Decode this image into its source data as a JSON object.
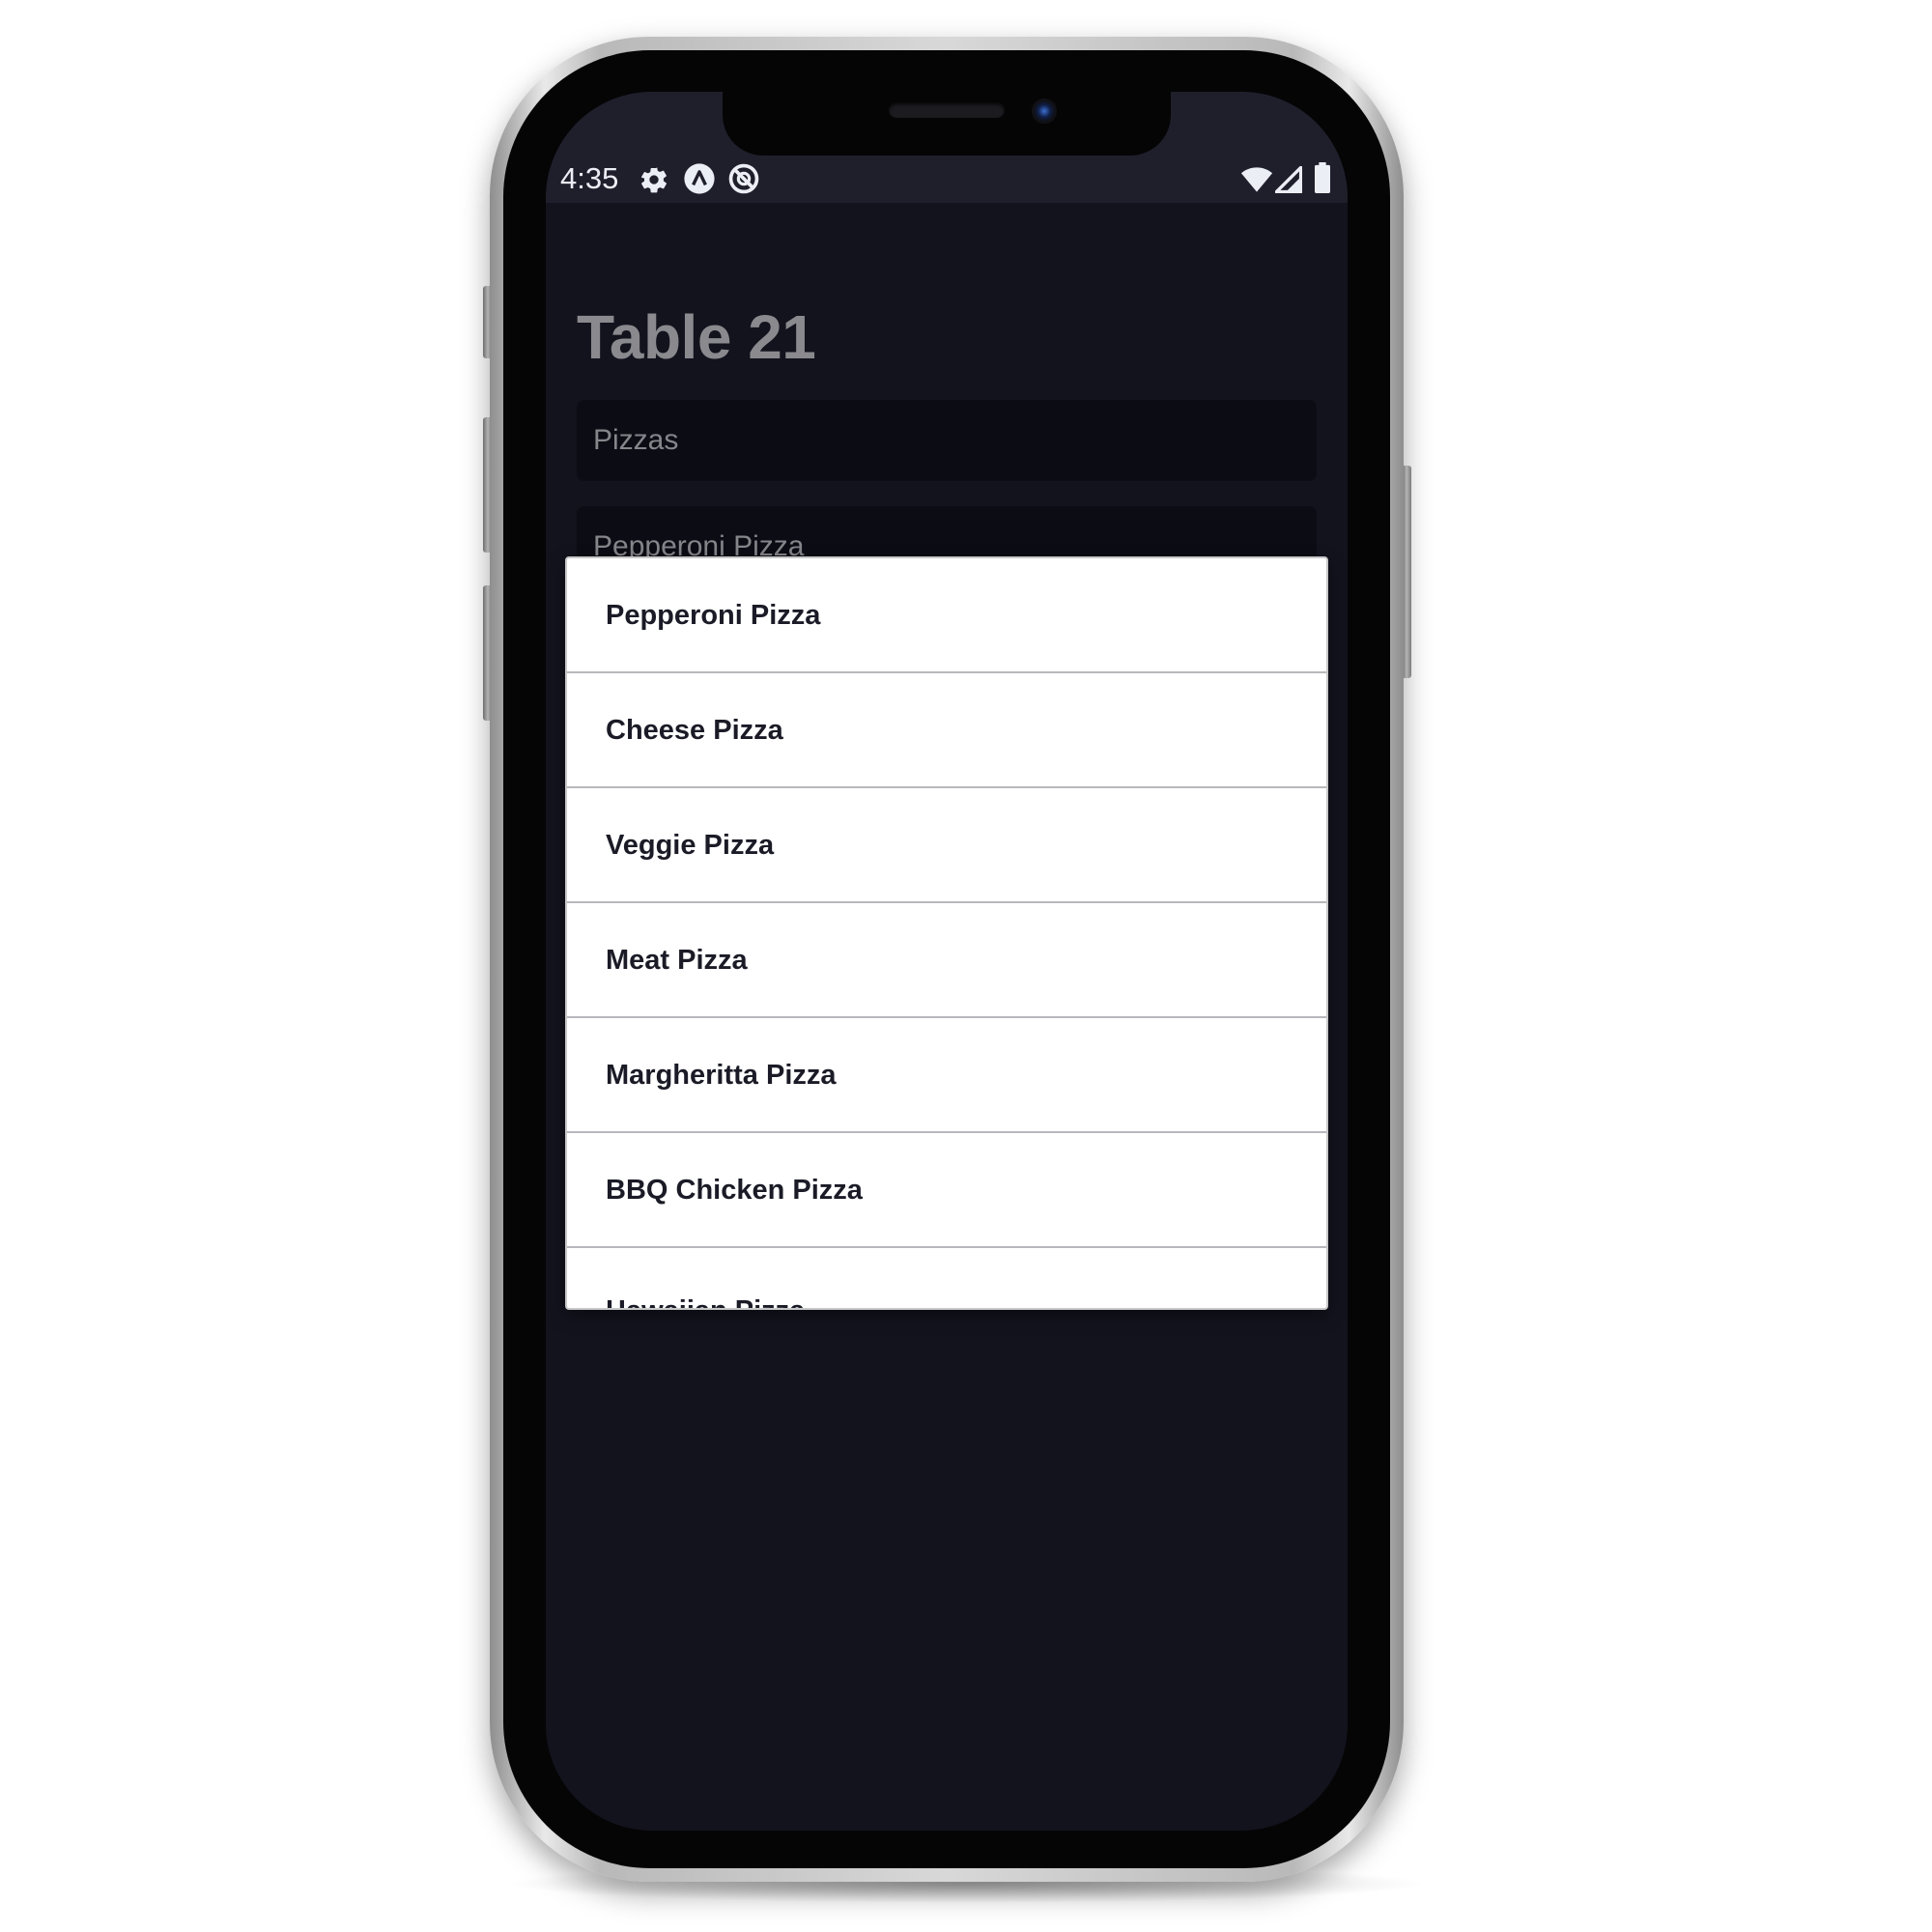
{
  "status_bar": {
    "time": "4:35",
    "left_icons": [
      "gear-icon",
      "a-circle-icon",
      "notification-off-icon"
    ],
    "right_icons": [
      "wifi-icon",
      "signal-icon",
      "battery-icon"
    ]
  },
  "page": {
    "title": "Table 21",
    "category_select_value": "Pizzas",
    "item_select_value": "Pepperoni Pizza"
  },
  "dropdown": {
    "options": [
      "Pepperoni Pizza",
      "Cheese Pizza",
      "Veggie Pizza",
      "Meat Pizza",
      "Margheritta Pizza",
      "BBQ Chicken Pizza",
      "Hawaiian Pizza"
    ]
  },
  "colors": {
    "screen_background": "#13131e",
    "status_bar_background": "#1f1f2c",
    "field_background": "#0c0c15",
    "dropdown_background": "#ffffff",
    "option_text": "#1b1b27"
  }
}
